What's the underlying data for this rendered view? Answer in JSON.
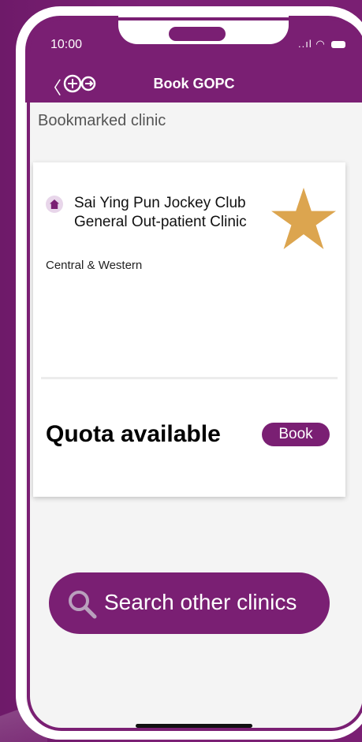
{
  "status_bar": {
    "time": "10:00",
    "signal": "..ıl"
  },
  "header": {
    "title": "Book GOPC",
    "back_glyph": "〈"
  },
  "section": {
    "title": "Bookmarked clinic"
  },
  "clinic": {
    "name": "Sai Ying Pun Jockey Club General Out-patient Clinic",
    "district": "Central & Western",
    "quota_status": "Quota available",
    "book_label": "Book",
    "bookmark_color": "#dca54f"
  },
  "search": {
    "label": "Search other clinics"
  },
  "colors": {
    "brand": "#7a1f73",
    "background": "#f4f4f4"
  }
}
